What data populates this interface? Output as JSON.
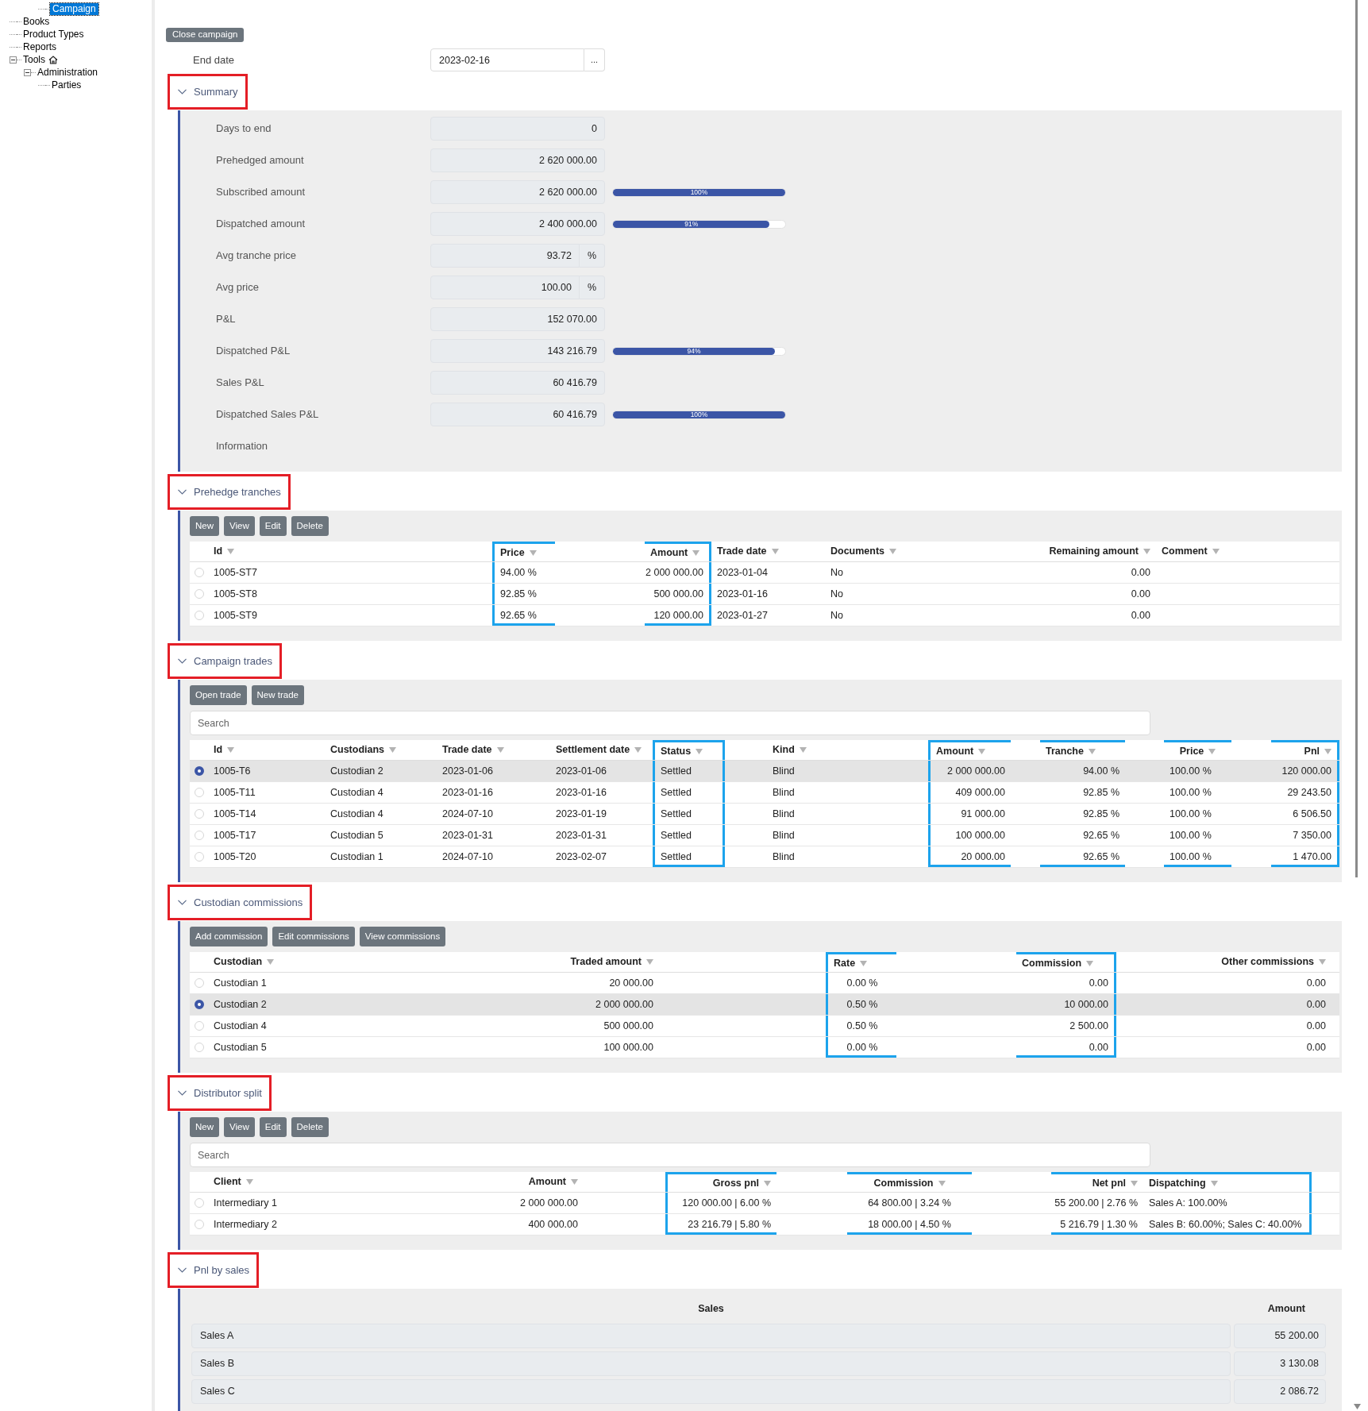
{
  "sidebar": {
    "tree": [
      {
        "children": [
          {
            "children": [
              {
                "label": "Campaign",
                "selected": true
              }
            ]
          }
        ]
      },
      {
        "label": "Books",
        "selected": false
      },
      {
        "label": "Product Types",
        "selected": false
      },
      {
        "label": "Reports",
        "selected": false
      },
      {
        "label": "Tools",
        "selected": false,
        "has_icon": true,
        "expanded": true,
        "children": [
          {
            "label": "Administration",
            "selected": false,
            "expanded": true,
            "children": [
              {
                "label": "Parties",
                "selected": false
              }
            ]
          }
        ]
      }
    ]
  },
  "close_button": "Close campaign",
  "end_date": {
    "label": "End date",
    "value": "2023-02-16",
    "picker": "..."
  },
  "sections": [
    {
      "kind": "summary",
      "title": "Summary",
      "expanded": true,
      "annotated": true,
      "rows": [
        {
          "kind": "field",
          "label": "Days to end",
          "value": "0"
        },
        {
          "kind": "field",
          "label": "Prehedged amount",
          "value": "2 620 000.00"
        },
        {
          "kind": "bar",
          "label": "Subscribed amount",
          "value": "2 620 000.00",
          "level": 1,
          "reading": "100%"
        },
        {
          "kind": "bar",
          "label": "Dispatched amount",
          "value": "2 400 000.00",
          "level": 0.91,
          "reading": "91%"
        },
        {
          "kind": "unit",
          "label": "Avg tranche price",
          "value": "93.72",
          "unit": "%"
        },
        {
          "kind": "unit",
          "label": "Avg price",
          "value": "100.00",
          "unit": "%"
        },
        {
          "kind": "field",
          "label": "P&L",
          "value": "152 070.00"
        },
        {
          "kind": "bar",
          "label": "Dispatched P&L",
          "value": "143 216.79",
          "level": 0.94,
          "reading": "94%"
        },
        {
          "kind": "field",
          "label": "Sales P&L",
          "value": "60 416.79"
        },
        {
          "kind": "bar",
          "label": "Dispatched Sales P&L",
          "value": "60 416.79",
          "level": 1,
          "reading": "100%"
        },
        {
          "kind": "label",
          "label": "Information"
        }
      ]
    },
    {
      "kind": "table",
      "title": "Prehedge tranches",
      "expanded": true,
      "annotated": true,
      "buttons": [
        "New",
        "View",
        "Edit",
        "Delete"
      ],
      "columns": [
        {
          "label": "Id",
          "annotated": false
        },
        {
          "label": "Price",
          "annotated": true
        },
        {
          "label": "Amount",
          "annotated": true
        },
        {
          "label": "Trade date",
          "annotated": false
        },
        {
          "label": "Documents",
          "annotated": false
        },
        {
          "label": "Remaining amount",
          "annotated": false
        },
        {
          "label": "Comment",
          "annotated": false
        }
      ],
      "rows": [
        {
          "selected": false,
          "cells": [
            "1005-ST7",
            "94.00 %",
            "2 000 000.00",
            "2023-01-04",
            "No",
            "0.00"
          ]
        },
        {
          "selected": false,
          "cells": [
            "1005-ST8",
            "92.85 %",
            "500 000.00",
            "2023-01-16",
            "No",
            "0.00"
          ]
        },
        {
          "selected": false,
          "cells": [
            "1005-ST9",
            "92.65 %",
            "120 000.00",
            "2023-01-27",
            "No",
            "0.00"
          ]
        }
      ]
    },
    {
      "kind": "table",
      "title": "Campaign trades",
      "expanded": true,
      "annotated": true,
      "buttons": [
        "Open trade",
        "New trade"
      ],
      "search": {
        "placeholder": "Search"
      },
      "columns": [
        {
          "label": "Id",
          "annotated": false
        },
        {
          "label": "Custodians",
          "annotated": false
        },
        {
          "label": "Trade date",
          "annotated": false
        },
        {
          "label": "Settlement date",
          "annotated": false
        },
        {
          "label": "Status",
          "annotated": true
        },
        {
          "label": "Kind",
          "annotated": false
        },
        {
          "label": "Amount",
          "annotated": true
        },
        {
          "label": "Tranche",
          "annotated": true
        },
        {
          "label": "Price",
          "annotated": true
        },
        {
          "label": "Pnl",
          "annotated": true
        }
      ],
      "rows": [
        {
          "selected": true,
          "cells": [
            "1005-T6",
            "Custodian 2",
            "2023-01-06",
            "2023-01-06",
            "Settled",
            "Blind",
            "2 000 000.00",
            "94.00 %",
            "100.00 %",
            "120 000.00"
          ]
        },
        {
          "selected": false,
          "cells": [
            "1005-T11",
            "Custodian 4",
            "2023-01-16",
            "2023-01-16",
            "Settled",
            "Blind",
            "409 000.00",
            "92.85 %",
            "100.00 %",
            "29 243.50"
          ]
        },
        {
          "selected": false,
          "cells": [
            "1005-T14",
            "Custodian 4",
            "2024-07-10",
            "2023-01-19",
            "Settled",
            "Blind",
            "91 000.00",
            "92.85 %",
            "100.00 %",
            "6 506.50"
          ]
        },
        {
          "selected": false,
          "cells": [
            "1005-T17",
            "Custodian 5",
            "2023-01-31",
            "2023-01-31",
            "Settled",
            "Blind",
            "100 000.00",
            "92.65 %",
            "100.00 %",
            "7 350.00"
          ]
        },
        {
          "selected": false,
          "cells": [
            "1005-T20",
            "Custodian 1",
            "2024-07-10",
            "2023-02-07",
            "Settled",
            "Blind",
            "20 000.00",
            "92.65 %",
            "100.00 %",
            "1 470.00"
          ]
        }
      ]
    },
    {
      "kind": "table",
      "title": "Custodian commissions",
      "expanded": true,
      "annotated": true,
      "buttons": [
        "Add commission",
        "Edit commissions",
        "View commissions"
      ],
      "columns": [
        {
          "label": "Custodian",
          "annotated": false
        },
        {
          "label": "Traded amount",
          "annotated": false
        },
        {
          "label": "Rate",
          "annotated": true
        },
        {
          "label": "Commission",
          "annotated": true
        },
        {
          "label": "Other commissions",
          "annotated": false
        }
      ],
      "rows": [
        {
          "selected": false,
          "cells": [
            "Custodian 1",
            "20 000.00",
            "0.00 %",
            "0.00",
            "0.00"
          ]
        },
        {
          "selected": true,
          "cells": [
            "Custodian 2",
            "2 000 000.00",
            "0.50 %",
            "10 000.00",
            "0.00"
          ]
        },
        {
          "selected": false,
          "cells": [
            "Custodian 4",
            "500 000.00",
            "0.50 %",
            "2 500.00",
            "0.00"
          ]
        },
        {
          "selected": false,
          "cells": [
            "Custodian 5",
            "100 000.00",
            "0.00 %",
            "0.00",
            "0.00"
          ]
        }
      ]
    },
    {
      "kind": "table",
      "title": "Distributor split",
      "expanded": true,
      "annotated": true,
      "buttons": [
        "New",
        "View",
        "Edit",
        "Delete"
      ],
      "search": {
        "placeholder": "Search"
      },
      "columns": [
        {
          "label": "Client",
          "annotated": false
        },
        {
          "label": "Amount",
          "annotated": false
        },
        {
          "label": "Gross pnl",
          "annotated": true
        },
        {
          "label": "Commission",
          "annotated": true
        },
        {
          "label": "Net pnl",
          "annotated": true
        },
        {
          "label": "Dispatching",
          "annotated": true
        }
      ],
      "rows": [
        {
          "selected": false,
          "cells": [
            "Intermediary 1",
            "2 000 000.00",
            "120 000.00 | 6.00 %",
            "64 800.00 | 3.24 %",
            "55 200.00 | 2.76 %",
            "Sales A: 100.00%"
          ]
        },
        {
          "selected": false,
          "cells": [
            "Intermediary 2",
            "400 000.00",
            "23 216.79 | 5.80 %",
            "18 000.00 | 4.50 %",
            "5 216.79 | 1.30 %",
            "Sales B: 60.00%; Sales C: 40.00%"
          ]
        }
      ]
    },
    {
      "kind": "sales",
      "title": "Pnl by sales",
      "expanded": true,
      "annotated": true,
      "columns": [
        "Sales",
        "Amount"
      ],
      "rows": [
        [
          "Sales A",
          "55 200.00"
        ],
        [
          "Sales B",
          "3 130.08"
        ],
        [
          "Sales C",
          "2 086.72"
        ]
      ]
    }
  ]
}
